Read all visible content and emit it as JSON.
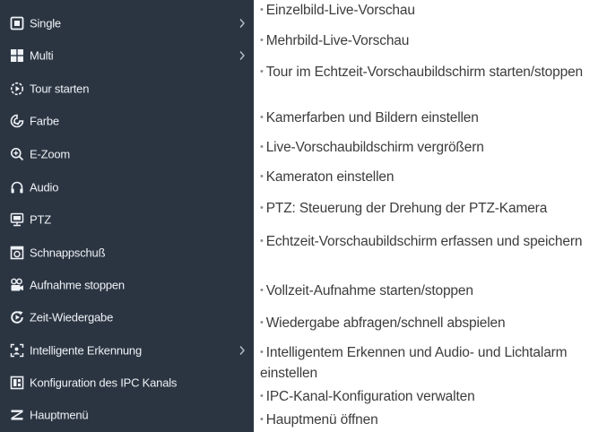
{
  "menu": {
    "items": [
      {
        "label": "Single",
        "icon": "single-view-icon",
        "has_submenu": true
      },
      {
        "label": "Multi",
        "icon": "multi-view-icon",
        "has_submenu": true
      },
      {
        "label": "Tour starten",
        "icon": "tour-icon",
        "has_submenu": false
      },
      {
        "label": "Farbe",
        "icon": "color-icon",
        "has_submenu": false
      },
      {
        "label": "E-Zoom",
        "icon": "zoom-icon",
        "has_submenu": false
      },
      {
        "label": "Audio",
        "icon": "headphones-icon",
        "has_submenu": false
      },
      {
        "label": "PTZ",
        "icon": "ptz-icon",
        "has_submenu": false
      },
      {
        "label": "Schnappschuß",
        "icon": "snapshot-icon",
        "has_submenu": false
      },
      {
        "label": "Aufnahme stoppen",
        "icon": "record-icon",
        "has_submenu": false
      },
      {
        "label": "Zeit-Wiedergabe",
        "icon": "playback-icon",
        "has_submenu": false
      },
      {
        "label": "Intelligente Erkennung",
        "icon": "intelligent-detection-icon",
        "has_submenu": true
      },
      {
        "label": "Konfiguration des IPC Kanals",
        "icon": "ipc-config-icon",
        "has_submenu": false
      },
      {
        "label": "Hauptmenü",
        "icon": "main-menu-icon",
        "has_submenu": false
      }
    ]
  },
  "bullet": "•",
  "descriptions": [
    "Einzelbild-Live-Vorschau",
    "Mehrbild-Live-Vorschau",
    "Tour im Echtzeit-Vorschaubildschirm starten/stoppen",
    "Kamerfarben und Bildern einstellen",
    "Live-Vorschaubildschirm vergrößern",
    "Kameraton einstellen",
    "PTZ: Steuerung der Drehung der PTZ-Kamera",
    "Echtzeit-Vorschaubildschirm erfassen und speichern",
    "Vollzeit-Aufnahme starten/stoppen",
    "Wiedergabe abfragen/schnell abspielen",
    "Intelligentem Erkennen und Audio- und Lichtalarm einstellen",
    "IPC-Kanal-Konfiguration verwalten",
    "Hauptmenü öffnen"
  ],
  "colors": {
    "menu_background": "#2b3542",
    "menu_text": "#eef1f5",
    "description_text": "#3c3c3c"
  }
}
